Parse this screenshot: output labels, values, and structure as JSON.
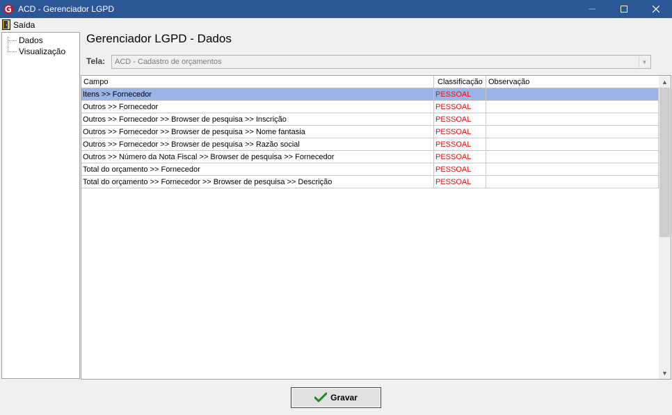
{
  "window": {
    "title": "ACD - Gerenciador LGPD"
  },
  "menu": {
    "exit_label": "Saída"
  },
  "sidebar": {
    "items": [
      {
        "label": "Dados"
      },
      {
        "label": "Visualização"
      }
    ]
  },
  "page": {
    "title": "Gerenciador LGPD - Dados"
  },
  "tela": {
    "label": "Tela:",
    "value": "ACD - Cadastro de orçamentos"
  },
  "grid": {
    "columns": [
      "Campo",
      "Classificação",
      "Observação"
    ],
    "rows": [
      {
        "campo": "Itens >> Fornecedor",
        "classificacao": "PESSOAL",
        "observacao": ""
      },
      {
        "campo": "Outros >> Fornecedor",
        "classificacao": "PESSOAL",
        "observacao": ""
      },
      {
        "campo": "Outros >> Fornecedor >> Browser de pesquisa >> Inscrição",
        "classificacao": "PESSOAL",
        "observacao": ""
      },
      {
        "campo": "Outros >> Fornecedor >> Browser de pesquisa >> Nome fantasia",
        "classificacao": "PESSOAL",
        "observacao": ""
      },
      {
        "campo": "Outros >> Fornecedor >> Browser de pesquisa >> Razão social",
        "classificacao": "PESSOAL",
        "observacao": ""
      },
      {
        "campo": "Outros >> Número da Nota Fiscal >> Browser de pesquisa >> Fornecedor",
        "classificacao": "PESSOAL",
        "observacao": ""
      },
      {
        "campo": "Total do orçamento >> Fornecedor",
        "classificacao": "PESSOAL",
        "observacao": ""
      },
      {
        "campo": "Total do orçamento >> Fornecedor >> Browser de pesquisa >> Descrição",
        "classificacao": "PESSOAL",
        "observacao": ""
      }
    ],
    "selected_row": 0
  },
  "actions": {
    "save_label": "Gravar"
  },
  "colors": {
    "titlebar": "#2b5797",
    "selected_row": "#99b4e6",
    "classification_text": "#e01010"
  }
}
